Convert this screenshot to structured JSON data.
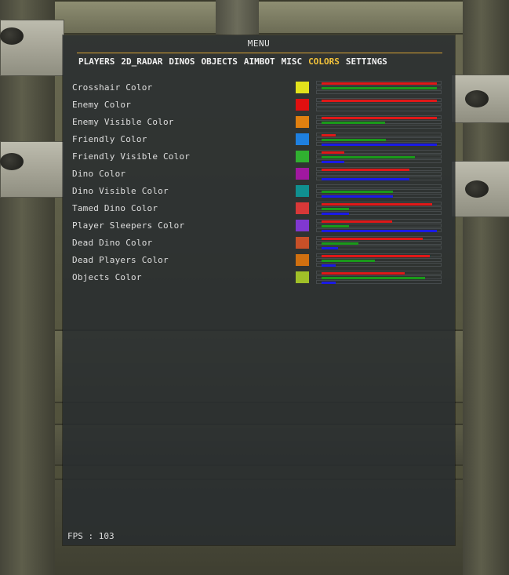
{
  "menu": {
    "title": "MENU",
    "tabs": [
      {
        "label": "PLAYERS",
        "active": false
      },
      {
        "label": "2D_RADAR",
        "active": false
      },
      {
        "label": "DINOS",
        "active": false
      },
      {
        "label": "OBJECTS",
        "active": false
      },
      {
        "label": "AIMBOT",
        "active": false
      },
      {
        "label": "MISC",
        "active": false
      },
      {
        "label": "COLORS",
        "active": true
      },
      {
        "label": "SETTINGS",
        "active": false
      }
    ],
    "accent_color": "#d9a233",
    "active_tab_color": "#f5c43a",
    "fps_text": "FPS : 103"
  },
  "colors": [
    {
      "label": "Crosshair Color",
      "hex": "#e2e21c",
      "r": 1.0,
      "g": 1.0,
      "b": 0.0
    },
    {
      "label": "Enemy Color",
      "hex": "#e01010",
      "r": 1.0,
      "g": 0.0,
      "b": 0.0
    },
    {
      "label": "Enemy Visible Color",
      "hex": "#e08010",
      "r": 1.0,
      "g": 0.55,
      "b": 0.0
    },
    {
      "label": "Friendly Color",
      "hex": "#1e80e0",
      "r": 0.12,
      "g": 0.56,
      "b": 1.0
    },
    {
      "label": "Friendly Visible Color",
      "hex": "#30b030",
      "r": 0.2,
      "g": 0.81,
      "b": 0.2
    },
    {
      "label": "Dino Color",
      "hex": "#a018a0",
      "r": 0.76,
      "g": 0.0,
      "b": 0.76
    },
    {
      "label": "Dino Visible Color",
      "hex": "#109090",
      "r": 0.0,
      "g": 0.62,
      "b": 0.62
    },
    {
      "label": "Tamed Dino Color",
      "hex": "#d83838",
      "r": 0.96,
      "g": 0.24,
      "b": 0.24
    },
    {
      "label": "Player Sleepers Color",
      "hex": "#8038d0",
      "r": 0.61,
      "g": 0.24,
      "b": 1.0
    },
    {
      "label": "Dead Dino Color",
      "hex": "#c85028",
      "r": 0.88,
      "g": 0.32,
      "b": 0.14
    },
    {
      "label": "Dead Players Color",
      "hex": "#d07010",
      "r": 0.94,
      "g": 0.46,
      "b": 0.12
    },
    {
      "label": "Objects Color",
      "hex": "#a0c028",
      "r": 0.72,
      "g": 0.9,
      "b": 0.12
    }
  ]
}
